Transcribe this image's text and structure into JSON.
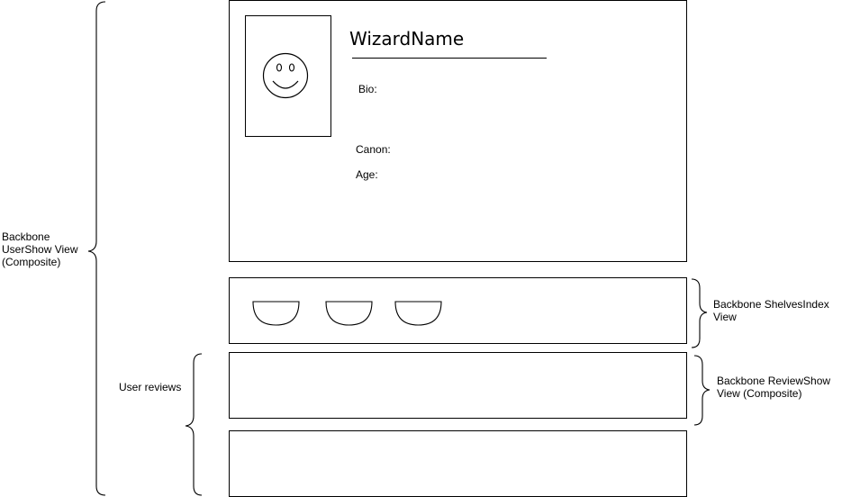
{
  "annotations": {
    "usershow": [
      "Backbone",
      "UserShow View",
      "(Composite)"
    ],
    "user_reviews": "User reviews",
    "shelves_index": [
      "Backbone ShelvesIndex",
      "View"
    ],
    "review_show": [
      "Backbone ReviewShow",
      "View (Composite)"
    ]
  },
  "profile": {
    "name": "WizardName",
    "bio_label": "Bio:",
    "canon_label": "Canon:",
    "age_label": "Age:"
  },
  "shelves": {
    "count": 3
  },
  "colors": {
    "stroke": "#000000",
    "background": "#ffffff"
  }
}
